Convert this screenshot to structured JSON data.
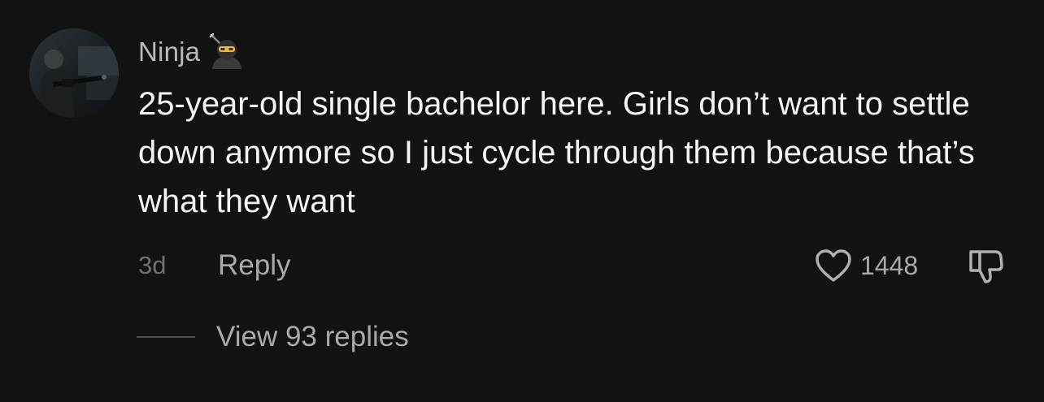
{
  "comment": {
    "username": "Ninja",
    "username_emoji_icon": "ninja-emoji-icon",
    "text": "25-year-old single bachelor here. Girls don’t want to settle down anymore so I just cycle through them because that’s what they want",
    "time": "3d",
    "reply_label": "Reply",
    "like_icon": "heart-outline-icon",
    "like_count": "1448",
    "dislike_icon": "thumbs-down-icon",
    "view_replies_label": "View 93 replies"
  },
  "colors": {
    "background": "#121212",
    "text_primary": "#f4f4f4",
    "text_secondary": "#a9a9a9",
    "text_muted": "#6f6f6f"
  }
}
